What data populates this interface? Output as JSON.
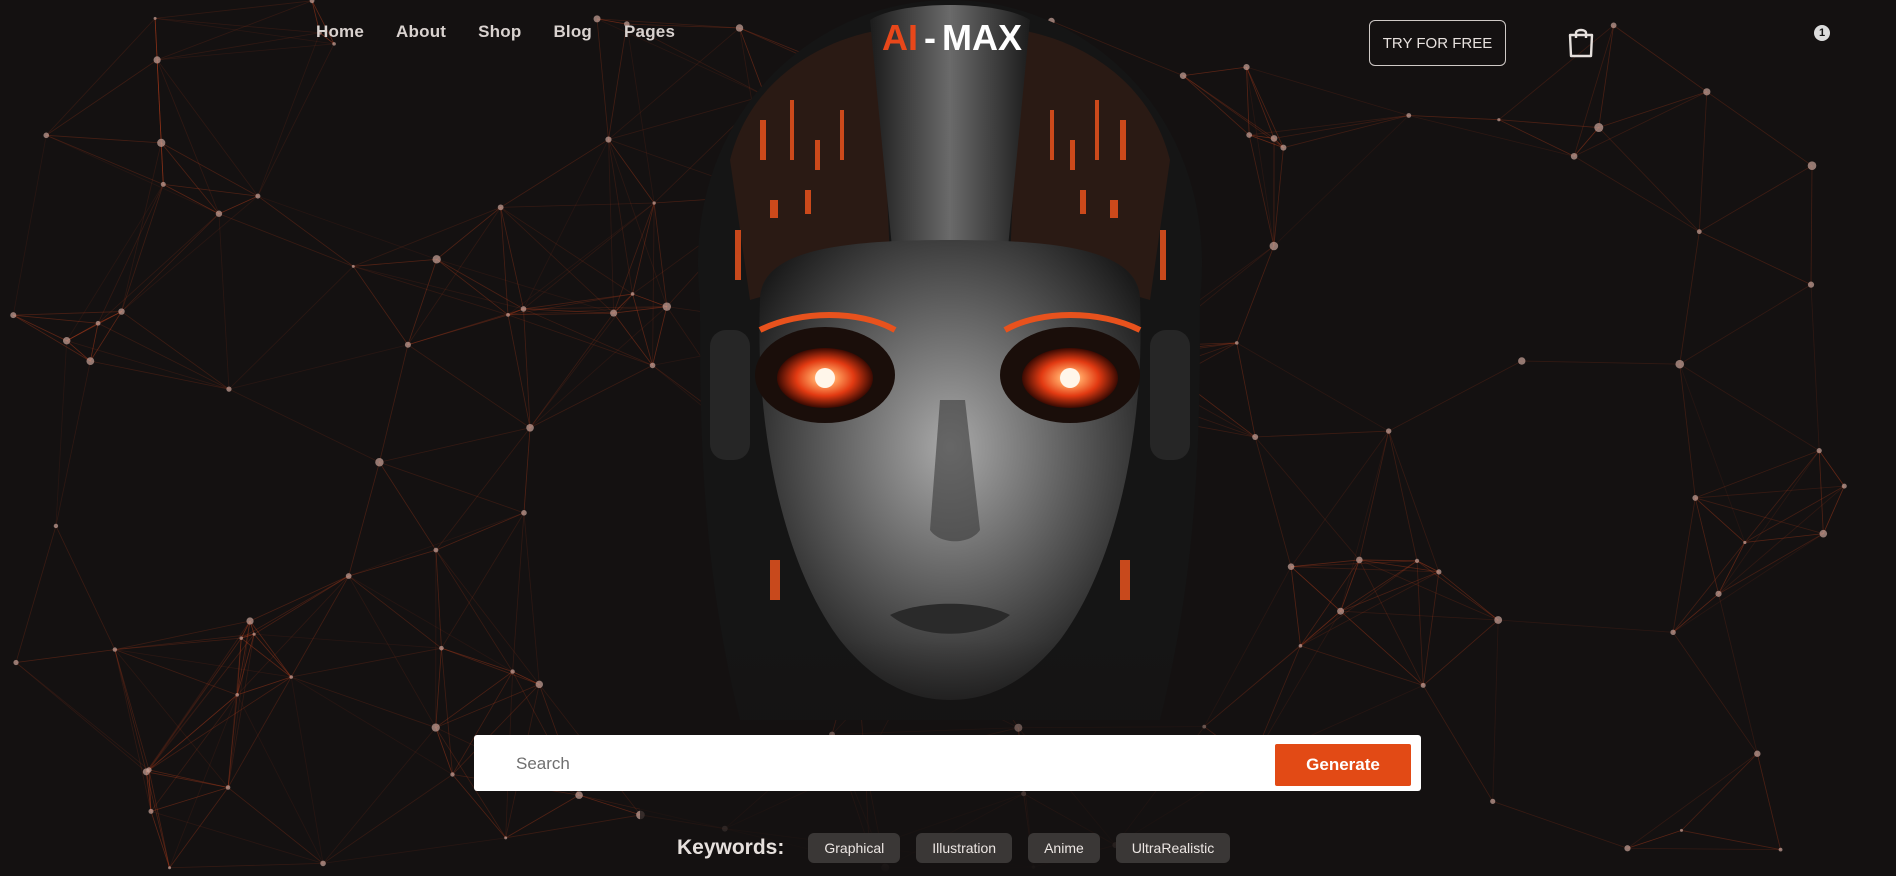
{
  "nav": {
    "items": [
      {
        "label": "Home"
      },
      {
        "label": "About"
      },
      {
        "label": "Shop"
      },
      {
        "label": "Blog"
      },
      {
        "label": "Pages"
      }
    ]
  },
  "logo": {
    "part1": "AI",
    "separator": "-",
    "part2": "MAX"
  },
  "header": {
    "try_label": "TRY FOR FREE",
    "cart_icon": "shopping-bag-icon",
    "cart_count": "1"
  },
  "search": {
    "placeholder": "Search",
    "value": "",
    "generate_label": "Generate"
  },
  "keywords": {
    "label": "Keywords:",
    "chips": [
      "Graphical",
      "Illustration",
      "Anime",
      "UltraRealistic"
    ]
  },
  "colors": {
    "accent": "#e24a15",
    "background": "#141111",
    "network_lines": "#c2401c"
  },
  "hero_image": "robot-face-illustration"
}
